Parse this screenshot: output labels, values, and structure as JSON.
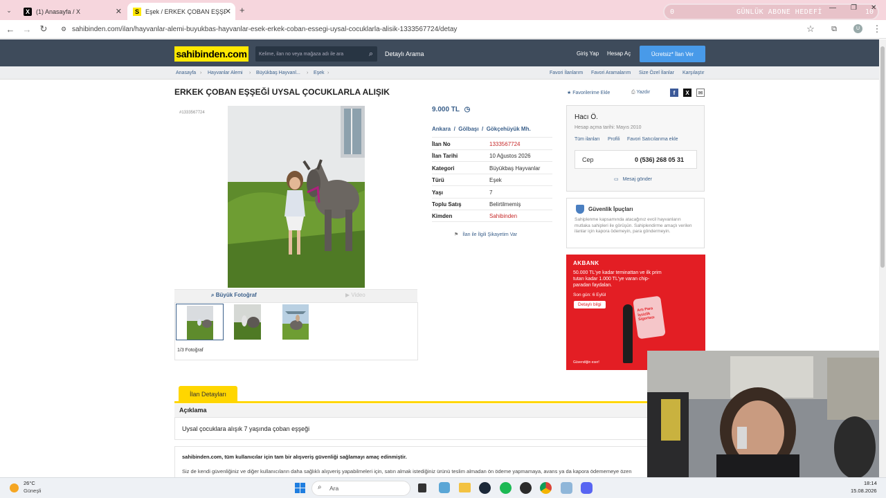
{
  "browser": {
    "tabs": [
      {
        "title": "(1) Anasayfa / X"
      },
      {
        "title": "Eşek / ERKEK ÇOBAN EŞŞEĞİ UY"
      }
    ],
    "url": "sahibinden.com/ilan/hayvanlar-alemi-buyukbas-hayvanlar-esek-erkek-coban-essegi-uysal-cocuklarla-alisik-1333567724/detay",
    "overlay": {
      "left": "0",
      "label": "GÜNLÜK ABONE HEDEFİ",
      "right": "10"
    }
  },
  "header": {
    "logo": "sahibinden.com",
    "search_placeholder": "Kelime, ilan no veya mağaza adı ile ara",
    "detailed_search": "Detaylı Arama",
    "login": "Giriş Yap",
    "register": "Hesap Aç",
    "post_button": "Ücretsiz* İlan Ver"
  },
  "breadcrumb": {
    "items": [
      "Anasayfa",
      "Hayvanlar Alemi",
      "Büyükbaş Hayvanl...",
      "Eşek"
    ],
    "right_links": [
      "Favori İlanlarım",
      "Favori Aramalarım",
      "Size Özel İlanlar",
      "Karşılaştır"
    ]
  },
  "listing": {
    "title": "ERKEK ÇOBAN EŞŞEĞİ UYSAL ÇOCUKLARLA ALIŞIK",
    "add_favorite": "Favorilerime Ekle",
    "print": "Yazdır",
    "id_label": "#1333567724",
    "big_photo": "Büyük Fotoğraf",
    "video": "Video",
    "photo_count": "1/3 Fotoğraf",
    "price": "9.000 TL",
    "location": "Ankara  /  Gölbaşı  /  Gökçehüyük Mh.",
    "rows": [
      {
        "k": "İlan No",
        "v": "1333567724"
      },
      {
        "k": "İlan Tarihi",
        "v": "10 Ağustos 2026"
      },
      {
        "k": "Kategori",
        "v": "Büyükbaş Hayvanlar"
      },
      {
        "k": "Türü",
        "v": "Eşek"
      },
      {
        "k": "Yaşı",
        "v": "7"
      },
      {
        "k": "Toplu Satış",
        "v": "Belirtilmemiş"
      },
      {
        "k": "Kimden",
        "v": "Sahibinden"
      }
    ],
    "complaint": "İlan ile İlgili Şikayetim Var"
  },
  "seller": {
    "name": "Hacı Ö.",
    "since": "Hesap açma tarihi: Mayıs 2010",
    "links": [
      "Tüm ilanları",
      "Profili",
      "Favori Satıcılarıma ekle"
    ],
    "phone_label": "Cep",
    "phone": "0 (536) 268 05 31",
    "message": "Mesaj gönder"
  },
  "safety": {
    "title": "Güvenlik İpuçları",
    "text": "Sahiplenme kapsamında atacağınız evcil hayvanların mutlaka sahipleri ile görüşün. Sahiplendirme amaçlı verilen ilanlar için kapora ödemeyin, para göndermeyin."
  },
  "ad": {
    "brand": "AKBANK",
    "headline": "50.000 TL'ye kadar teminattan ve ilk prim tutarı kadar 1.000 TL'ye varan chip-paradan faydalan.",
    "deadline": "Son gün: 6 Eylül",
    "cta": "Detaylı bilgi",
    "product": "Artı Para İşsizlik Sigortası",
    "footer": "Güvendiğin eser!"
  },
  "details": {
    "tab": "İlan Detayları",
    "section": "Açıklama",
    "description": "Uysal çocuklara alışık 7 yaşında çoban eşşeği",
    "notice_title": "sahibinden.com, tüm kullanıcılar için tam bir alışveriş güvenliği sağlamayı amaç edinmiştir.",
    "notice_text": "Siz de kendi güvenliğiniz ve diğer kullanıcıların daha sağlıklı alışveriş yapabilmeleri için, satın almak istediğiniz ürünü teslim almadan ön ödeme yapmamaya, avans ya da kapora ödememeye özen"
  },
  "taskbar": {
    "weather_temp": "26°C",
    "weather_desc": "Güneşli",
    "search": "Ara",
    "time": "18:14",
    "date": "15.08.2026"
  },
  "colors": {
    "brand_yellow": "#ffe800",
    "header_bg": "#3e4b5b",
    "link_blue": "#3a5f8a",
    "price_blue": "#3a5f8a",
    "red": "#c62828",
    "ad_red": "#e31e24"
  }
}
